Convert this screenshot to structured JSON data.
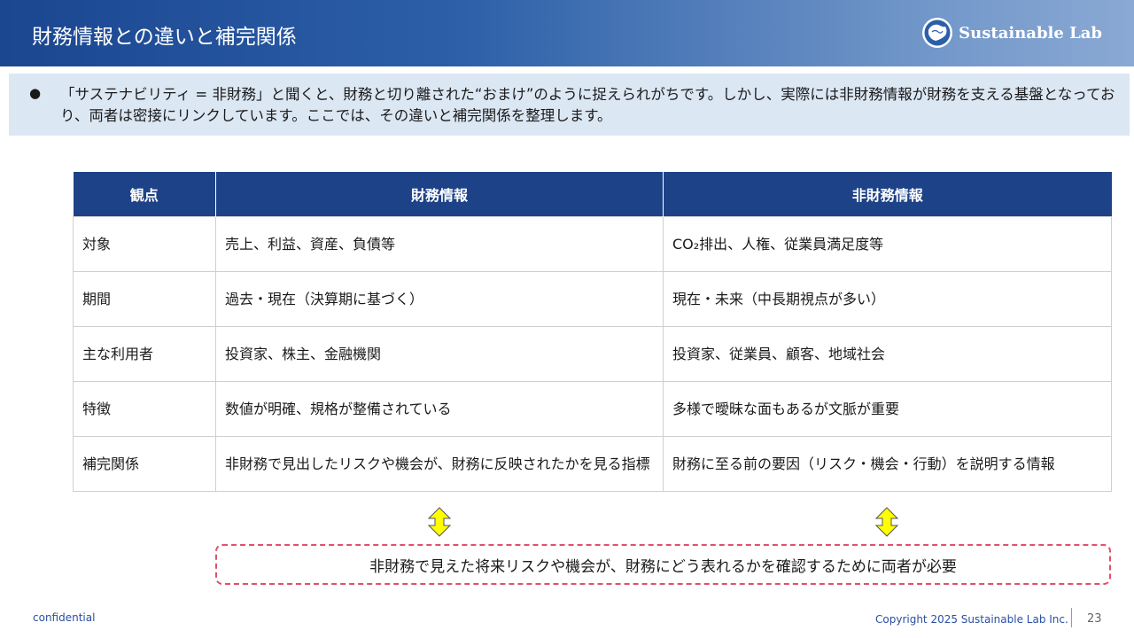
{
  "header": {
    "title": "財務情報との違いと補完関係",
    "logo_text": "Sustainable Lab"
  },
  "intro": {
    "bullet": "●",
    "text": "「サステナビリティ = 非財務」と聞くと、財務と切り離された“おまけ”のように捉えられがちです。しかし、実際には非財務情報が財務を支える基盤となっており、両者は密接にリンクしています。ここでは、その違いと補完関係を整理します。"
  },
  "table": {
    "headers": [
      "観点",
      "財務情報",
      "非財務情報"
    ],
    "rows": [
      [
        "対象",
        "売上、利益、資産、負債等",
        "CO₂排出、人権、従業員満足度等"
      ],
      [
        "期間",
        "過去・現在（決算期に基づく）",
        "現在・未来（中長期視点が多い）"
      ],
      [
        "主な利用者",
        "投資家、株主、金融機関",
        "投資家、従業員、顧客、地域社会"
      ],
      [
        "特徴",
        "数値が明確、規格が整備されている",
        "多様で曖昧な面もあるが文脈が重要"
      ],
      [
        "補完関係",
        "非財務で見出したリスクや機会が、財務に反映されたかを見る指標",
        "財務に至る前の要因（リスク・機会・行動）を説明する情報"
      ]
    ]
  },
  "callout": {
    "text": "非財務で見えた将来リスクや機会が、財務にどう表れるかを確認するために両者が必要"
  },
  "footer": {
    "confidential": "confidential",
    "copyright": "Copyright 2025 Sustainable Lab Inc.",
    "page": "23"
  },
  "colors": {
    "header_dark": "#1b4690",
    "table_header": "#1d4287",
    "intro_bg": "#dce7f4",
    "arrow_fill": "#ffff00",
    "callout_border": "#e0506a"
  },
  "icons": {
    "logo": "globe-logo-icon",
    "arrow": "up-down-arrow-icon"
  }
}
